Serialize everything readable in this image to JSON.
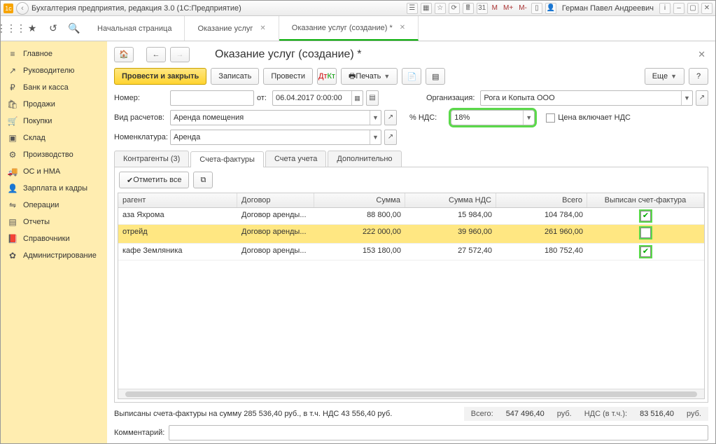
{
  "title": "Бухгалтерия предприятия, редакция 3.0  (1С:Предприятие)",
  "user": "Герман Павел Андреевич",
  "tb": {
    "m1": "M",
    "m2": "M+",
    "m3": "M-",
    "info": "i"
  },
  "sidebar": [
    {
      "label": "Главное",
      "icon": "≡"
    },
    {
      "label": "Руководителю",
      "icon": "↗"
    },
    {
      "label": "Банк и касса",
      "icon": "₽"
    },
    {
      "label": "Продажи",
      "icon": "🛍"
    },
    {
      "label": "Покупки",
      "icon": "🛒"
    },
    {
      "label": "Склад",
      "icon": "▣"
    },
    {
      "label": "Производство",
      "icon": "⚙"
    },
    {
      "label": "ОС и НМА",
      "icon": "🚚"
    },
    {
      "label": "Зарплата и кадры",
      "icon": "👤"
    },
    {
      "label": "Операции",
      "icon": "⇋"
    },
    {
      "label": "Отчеты",
      "icon": "▤"
    },
    {
      "label": "Справочники",
      "icon": "📕"
    },
    {
      "label": "Администрирование",
      "icon": "✿"
    }
  ],
  "toptabs": {
    "items": [
      {
        "label": "Начальная страница",
        "close": false
      },
      {
        "label": "Оказание услуг",
        "close": true
      },
      {
        "label": "Оказание услуг (создание) *",
        "close": true,
        "active": true
      }
    ]
  },
  "page": {
    "title": "Оказание услуг (создание) *",
    "toolbar": {
      "post_close": "Провести и закрыть",
      "save": "Записать",
      "post": "Провести",
      "print": "Печать",
      "more": "Еще",
      "help": "?"
    },
    "form": {
      "number_lbl": "Номер:",
      "number": "",
      "from_lbl": "от:",
      "date": "06.04.2017  0:00:00",
      "org_lbl": "Организация:",
      "org": "Рога и Копыта ООО",
      "calc_lbl": "Вид расчетов:",
      "calc": "Аренда помещения",
      "vat_lbl": "% НДС:",
      "vat": "18%",
      "price_incl_lbl": "Цена включает НДС",
      "nom_lbl": "Номенклатура:",
      "nom": "Аренда"
    },
    "subtabs": [
      {
        "label": "Контрагенты (3)"
      },
      {
        "label": "Счета-фактуры",
        "active": true
      },
      {
        "label": "Счета учета"
      },
      {
        "label": "Дополнительно"
      }
    ],
    "tbltool": {
      "mark_all": "Отметить все"
    },
    "columns": [
      "рагент",
      "Договор",
      "Сумма",
      "Сумма НДС",
      "Всего",
      "Выписан счет-фактура"
    ],
    "rows": [
      {
        "c1": "аза Яхрома",
        "c2": "Договор аренды...",
        "c3": "88 800,00",
        "c4": "15 984,00",
        "c5": "104 784,00",
        "chk": true
      },
      {
        "c1": "отрейд",
        "c2": "Договор аренды...",
        "c3": "222 000,00",
        "c4": "39 960,00",
        "c5": "261 960,00",
        "chk": false,
        "sel": true
      },
      {
        "c1": "кафе Земляника",
        "c2": "Договор аренды...",
        "c3": "153 180,00",
        "c4": "27 572,40",
        "c5": "180 752,40",
        "chk": true
      }
    ],
    "summary": "Выписаны счета-фактуры на сумму 285 536,40 руб., в т.ч. НДС 43 556,40 руб.",
    "totals": {
      "total_lbl": "Всего:",
      "total": "547 496,40",
      "cur": "руб.",
      "vat_lbl": "НДС (в т.ч.):",
      "vat": "83 516,40"
    },
    "comment_lbl": "Комментарий:"
  }
}
